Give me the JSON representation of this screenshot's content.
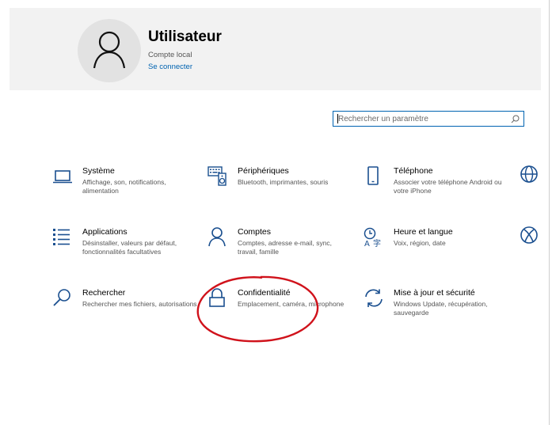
{
  "user": {
    "name": "Utilisateur",
    "account_type": "Compte local",
    "connect_link": "Se connecter"
  },
  "search": {
    "placeholder": "Rechercher un paramètre",
    "icon": "search-icon"
  },
  "categories": [
    {
      "title": "Système",
      "description": "Affichage, son, notifications, alimentation",
      "icon": "laptop-icon"
    },
    {
      "title": "Périphériques",
      "description": "Bluetooth, imprimantes, souris",
      "icon": "keyboard-speaker-icon"
    },
    {
      "title": "Téléphone",
      "description": "Associer votre téléphone Android ou votre iPhone",
      "icon": "phone-icon"
    },
    {
      "title": "Applications",
      "description": "Désinstaller, valeurs par défaut, fonctionnalités facultatives",
      "icon": "apps-list-icon"
    },
    {
      "title": "Comptes",
      "description": "Comptes, adresse e-mail, sync, travail, famille",
      "icon": "person-icon"
    },
    {
      "title": "Heure et langue",
      "description": "Voix, région, date",
      "icon": "time-language-icon"
    },
    {
      "title": "Rechercher",
      "description": "Rechercher mes fichiers, autorisations",
      "icon": "search-icon"
    },
    {
      "title": "Confidentialité",
      "description": "Emplacement, caméra, microphone",
      "icon": "lock-icon"
    },
    {
      "title": "Mise à jour et sécurité",
      "description": "Windows Update, récupération, sauvegarde",
      "icon": "update-sync-icon"
    }
  ],
  "partial_icons": [
    "globe-icon",
    "xbox-icon"
  ],
  "colors": {
    "accent": "#0063b1",
    "header_bg": "#f2f2f2",
    "annotation": "#d0121b"
  }
}
